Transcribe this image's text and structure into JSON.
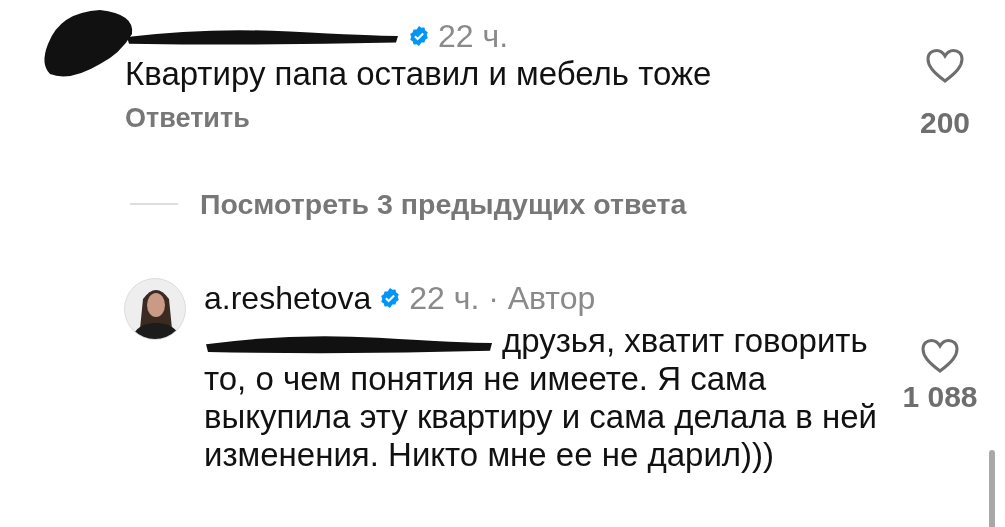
{
  "comments": [
    {
      "username_redacted": true,
      "avatar_redacted": true,
      "verified": true,
      "meta": "22 ч.",
      "text": "Квартиру папа оставил и мебель тоже",
      "reply": "Ответить",
      "liked": false,
      "likes": "200"
    }
  ],
  "view_replies": "Посмотреть 3 предыдущих ответа",
  "replies": [
    {
      "username": "a.reshetova",
      "verified": true,
      "meta": "22 ч. · Автор",
      "mention_redacted": true,
      "text": "друзья, хватит говорить то, о чем понятия не имеете. Я сама выкупила эту квартиру и сама делала в ней изменения. Никто мне ее не дарил)))",
      "liked": false,
      "likes": "1 088"
    }
  ]
}
